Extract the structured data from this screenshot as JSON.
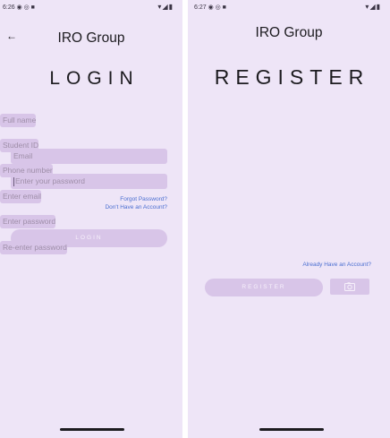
{
  "login": {
    "status_time": "6:26",
    "status_icons": "◉ ◎ ■",
    "status_right": "▾◢▮",
    "app_title": "IRO Group",
    "back_glyph": "←",
    "heading": "LOGIN",
    "email_placeholder": "Email",
    "password_placeholder": "Enter your password",
    "forgot_link": "Forgot Password?",
    "no_account_link": "Don't Have an Account?",
    "login_button": "LOGIN"
  },
  "register": {
    "status_time": "6:27",
    "status_icons": "◉ ◎ ■",
    "status_right": "▾◢▮",
    "app_title": "IRO Group",
    "heading": "REGISTER",
    "fields": [
      "Full name",
      "Student ID",
      "Phone number",
      "Enter email",
      "Enter password",
      "Re-enter password"
    ],
    "have_account_link": "Already Have an Account?",
    "register_button": "REGISTER",
    "camera_icon": "camera-icon"
  },
  "colors": {
    "background": "#eee5f7",
    "field": "#d8c5e8",
    "link": "#4b6fd1",
    "text": "#1c1b1f"
  }
}
